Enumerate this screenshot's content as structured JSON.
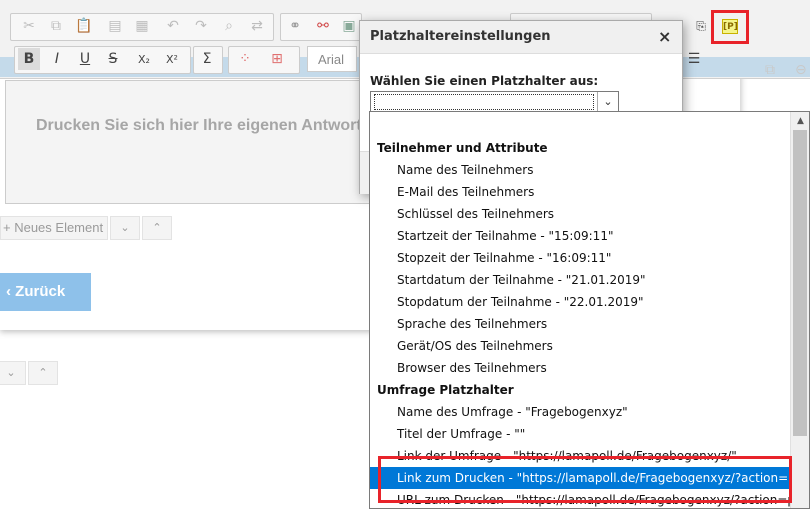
{
  "editor": {
    "font_name": "Arial",
    "placeholder_text": "Drucken Sie sich hier Ihre eigenen Antwort",
    "bold_label": "B",
    "italic_label": "I",
    "underline_label": "U",
    "strike_label": "S",
    "subscript_label": "X₂",
    "superscript_label": "X²",
    "sum_label": "Σ",
    "placeholder_icon_label": "[P]"
  },
  "actions": {
    "new_element_label": "+ Neues Element",
    "back_label": "‹ Zurück"
  },
  "dialog": {
    "title": "Platzhaltereinstellungen",
    "close_label": "×",
    "select_label": "Wählen Sie einen Platzhalter aus:",
    "select_value": ""
  },
  "dropdown": {
    "options": [
      {
        "type": "group",
        "label": "Teilnehmer und Attribute"
      },
      {
        "type": "item",
        "label": "Name des Teilnehmers"
      },
      {
        "type": "item",
        "label": "E-Mail des Teilnehmers"
      },
      {
        "type": "item",
        "label": "Schlüssel des Teilnehmers"
      },
      {
        "type": "item",
        "label": "Startzeit der Teilnahme - \"15:09:11\""
      },
      {
        "type": "item",
        "label": "Stopzeit der Teilnahme - \"16:09:11\""
      },
      {
        "type": "item",
        "label": "Startdatum der Teilnahme - \"21.01.2019\""
      },
      {
        "type": "item",
        "label": "Stopdatum der Teilnahme - \"22.01.2019\""
      },
      {
        "type": "item",
        "label": "Sprache des Teilnehmers"
      },
      {
        "type": "item",
        "label": "Gerät/OS des Teilnehmers"
      },
      {
        "type": "item",
        "label": "Browser des Teilnehmers"
      },
      {
        "type": "group",
        "label": "Umfrage Platzhalter"
      },
      {
        "type": "item",
        "label": "Name des Umfrage - \"Fragebogenxyz\""
      },
      {
        "type": "item",
        "label": "Titel der Umfrage - \"\""
      },
      {
        "type": "item",
        "label": "Link der Umfrage - \"https://lamapoll.de/Fragebogenxyz/\""
      },
      {
        "type": "item",
        "label": "Link zum Drucken - \"https://lamapoll.de/Fragebogenxyz/?action=print\"",
        "selected": true
      },
      {
        "type": "item",
        "label": "URL zum Drucken - \"https://lamapoll.de/Fragebogenxyz/?action=print\""
      }
    ]
  },
  "colors": {
    "selection": "#0078d7",
    "highlight": "#e8232a",
    "back_button": "#8ec1ea"
  }
}
